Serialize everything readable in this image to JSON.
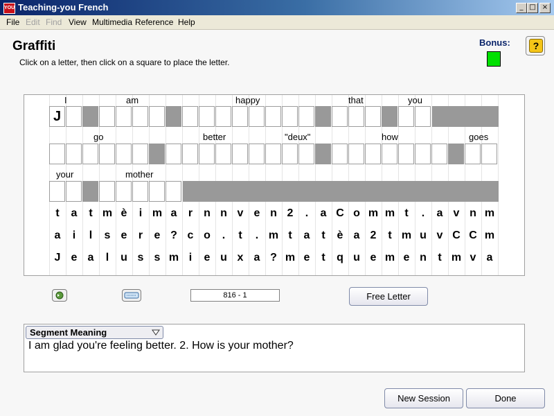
{
  "window": {
    "app_icon_text": "YOU",
    "title": "Teaching-you  French",
    "min_glyph": "_",
    "max_glyph": "□",
    "close_glyph": "×"
  },
  "menu": [
    {
      "label": "File",
      "enabled": true
    },
    {
      "label": "Edit",
      "enabled": false
    },
    {
      "label": "Find",
      "enabled": false
    },
    {
      "label": "View",
      "enabled": true
    },
    {
      "label": "Multimedia",
      "enabled": true
    },
    {
      "label": "Reference",
      "enabled": true
    },
    {
      "label": "Help",
      "enabled": true
    }
  ],
  "page": {
    "heading": "Graffiti",
    "instructions": "Click on a letter, then click on a square to place the letter.",
    "bonus_label": "Bonus:",
    "bonus_color": "#00e000",
    "help_glyph": "?"
  },
  "puzzle": {
    "rows": [
      {
        "words": [
          "I",
          "am",
          "happy",
          "that",
          "you"
        ],
        "first_letter": "J"
      },
      {
        "words": [
          "go",
          "better",
          "\"deux\"",
          "how",
          "goes"
        ]
      },
      {
        "words": [
          "your",
          "mother"
        ]
      }
    ],
    "letter_bank": [
      "tatmèimarnnven2.aCommt.avnm",
      "ailsere?co.t.mtatèa2tmuvCCm",
      "Jealussmieuxa?metquementmva"
    ]
  },
  "controls": {
    "code": "816 - 1",
    "free_letter_label": "Free Letter"
  },
  "meaning": {
    "dropdown_label": "Segment Meaning",
    "text": "I am glad you're feeling better. 2. How is your mother?"
  },
  "footer": {
    "new_session_label": "New Session",
    "done_label": "Done"
  }
}
